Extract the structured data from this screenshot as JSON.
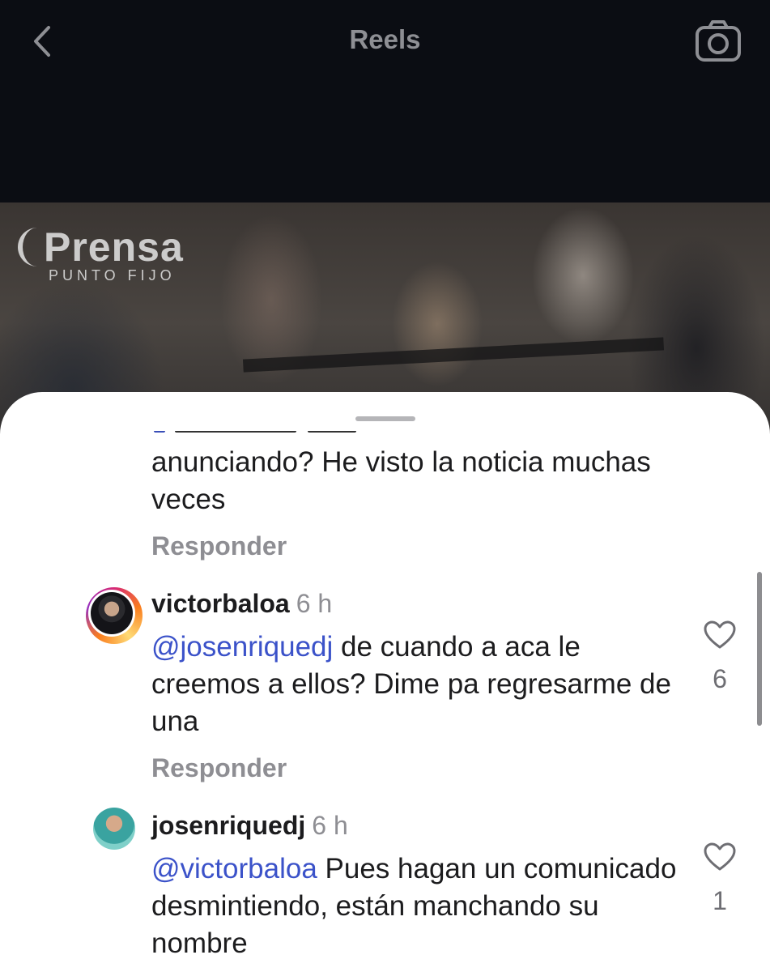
{
  "header": {
    "title": "Reels",
    "back_icon": "chevron-left-icon",
    "camera_icon": "camera-icon"
  },
  "video": {
    "logo_main": "Prensa",
    "logo_sub": "PUNTO FIJO"
  },
  "comments": [
    {
      "text": "anunciando? He visto la noticia muchas veces",
      "reply": "Responder"
    },
    {
      "username": "victorbaloa",
      "time": "6 h",
      "mention": "@josenriquedj",
      "text": " de cuando a aca le creemos a ellos? Dime pa regresarme de una",
      "likes": "6",
      "reply": "Responder"
    },
    {
      "username": "josenriquedj",
      "time": "6 h",
      "mention": "@victorbaloa",
      "text": " Pues hagan un comunicado desmintiendo, están manchando su nombre",
      "likes": "1"
    }
  ],
  "colors": {
    "mention": "#3b52c9",
    "muted": "#8e8e93",
    "text": "#1c1c1e"
  }
}
